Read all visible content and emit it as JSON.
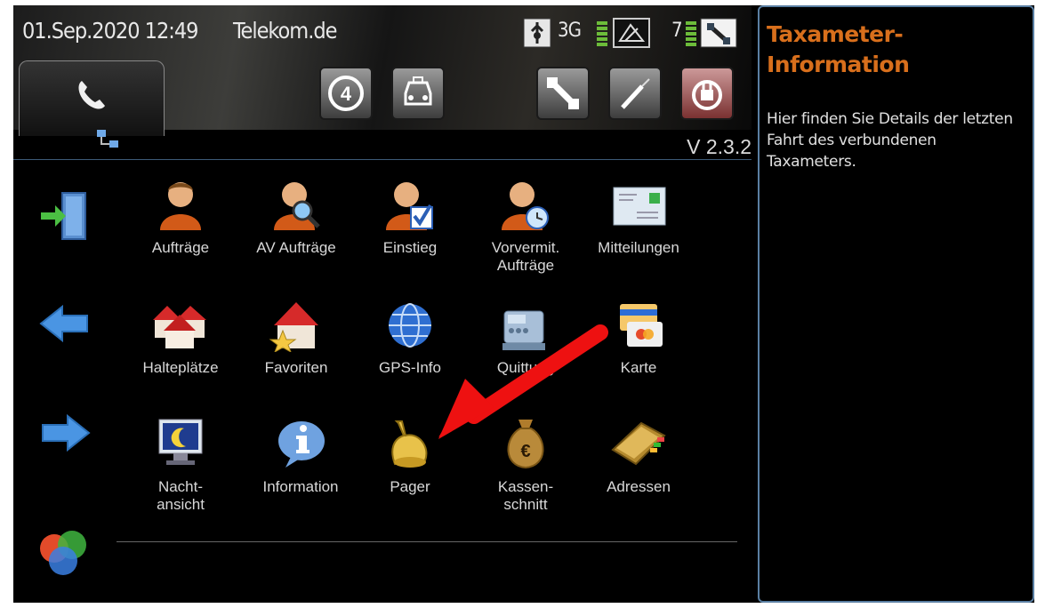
{
  "status": {
    "datetime": "01.Sep.2020 12:49",
    "carrier": "Telekom.de",
    "network_type": "3G",
    "satellite_count": "7"
  },
  "header": {
    "version": "V 2.3.2"
  },
  "grid": [
    {
      "label": "Aufträge",
      "icon": "person-icon"
    },
    {
      "label": "AV Aufträge",
      "icon": "person-search-icon"
    },
    {
      "label": "Einstieg",
      "icon": "person-check-icon"
    },
    {
      "label": "Vorvermit. Aufträge",
      "icon": "person-clock-icon"
    },
    {
      "label": "Mitteilungen",
      "icon": "envelope-icon"
    },
    {
      "label": "Halteplätze",
      "icon": "houses-icon"
    },
    {
      "label": "Favoriten",
      "icon": "house-star-icon"
    },
    {
      "label": "GPS-Info",
      "icon": "globe-icon"
    },
    {
      "label": "Quittung",
      "icon": "cash-register-icon"
    },
    {
      "label": "Karte",
      "icon": "credit-card-icon"
    },
    {
      "label": "Nacht-\nansicht",
      "icon": "monitor-moon-icon"
    },
    {
      "label": "Information",
      "icon": "info-bubble-icon"
    },
    {
      "label": "Pager",
      "icon": "bell-icon"
    },
    {
      "label": "Kassen-\nschnitt",
      "icon": "money-bag-icon"
    },
    {
      "label": "Adressen",
      "icon": "address-book-icon"
    }
  ],
  "panel": {
    "title": "Taxameter-Information",
    "text": "Hier finden Sie Details der letzten Fahrt des verbundenen Taxameters."
  },
  "colors": {
    "panel_title": "#d86f1c",
    "panel_border": "#5a7fa3",
    "annotation_arrow": "#ee1111"
  }
}
